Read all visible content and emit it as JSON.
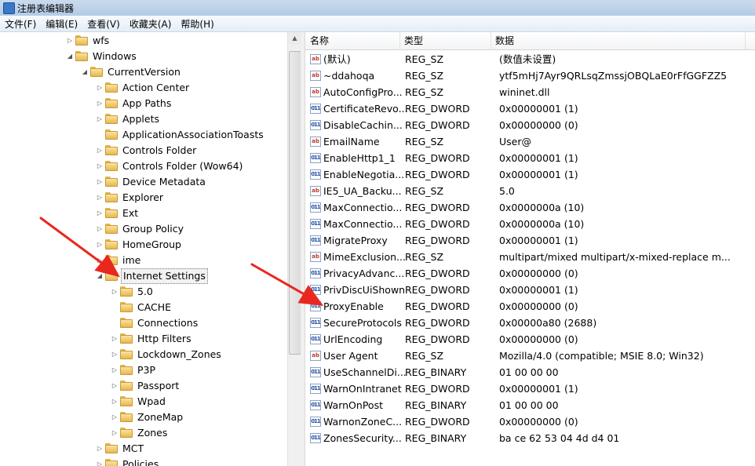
{
  "window": {
    "title": "注册表编辑器"
  },
  "menu": [
    "文件(F)",
    "编辑(E)",
    "查看(V)",
    "收藏夹(A)",
    "帮助(H)"
  ],
  "tree": [
    {
      "label": "wfs",
      "depth": 0,
      "arrow": "collapsed"
    },
    {
      "label": "Windows",
      "depth": 0,
      "arrow": "expanded"
    },
    {
      "label": "CurrentVersion",
      "depth": 1,
      "arrow": "expanded"
    },
    {
      "label": "Action Center",
      "depth": 2,
      "arrow": "collapsed"
    },
    {
      "label": "App Paths",
      "depth": 2,
      "arrow": "collapsed"
    },
    {
      "label": "Applets",
      "depth": 2,
      "arrow": "collapsed"
    },
    {
      "label": "ApplicationAssociationToasts",
      "depth": 2,
      "arrow": "none"
    },
    {
      "label": "Controls Folder",
      "depth": 2,
      "arrow": "collapsed"
    },
    {
      "label": "Controls Folder (Wow64)",
      "depth": 2,
      "arrow": "collapsed"
    },
    {
      "label": "Device Metadata",
      "depth": 2,
      "arrow": "collapsed"
    },
    {
      "label": "Explorer",
      "depth": 2,
      "arrow": "collapsed"
    },
    {
      "label": "Ext",
      "depth": 2,
      "arrow": "collapsed"
    },
    {
      "label": "Group Policy",
      "depth": 2,
      "arrow": "collapsed"
    },
    {
      "label": "HomeGroup",
      "depth": 2,
      "arrow": "collapsed"
    },
    {
      "label": "ime",
      "depth": 2,
      "arrow": "collapsed"
    },
    {
      "label": "Internet Settings",
      "depth": 2,
      "arrow": "expanded",
      "selected": true
    },
    {
      "label": "5.0",
      "depth": 3,
      "arrow": "collapsed"
    },
    {
      "label": "CACHE",
      "depth": 3,
      "arrow": "none"
    },
    {
      "label": "Connections",
      "depth": 3,
      "arrow": "none"
    },
    {
      "label": "Http Filters",
      "depth": 3,
      "arrow": "collapsed"
    },
    {
      "label": "Lockdown_Zones",
      "depth": 3,
      "arrow": "collapsed"
    },
    {
      "label": "P3P",
      "depth": 3,
      "arrow": "collapsed"
    },
    {
      "label": "Passport",
      "depth": 3,
      "arrow": "collapsed"
    },
    {
      "label": "Wpad",
      "depth": 3,
      "arrow": "collapsed"
    },
    {
      "label": "ZoneMap",
      "depth": 3,
      "arrow": "collapsed"
    },
    {
      "label": "Zones",
      "depth": 3,
      "arrow": "collapsed"
    },
    {
      "label": "MCT",
      "depth": 2,
      "arrow": "collapsed"
    },
    {
      "label": "Policies",
      "depth": 2,
      "arrow": "collapsed"
    }
  ],
  "list": {
    "columns": [
      "名称",
      "类型",
      "数据"
    ],
    "rows": [
      {
        "icon": "sz",
        "name": "(默认)",
        "type": "REG_SZ",
        "data": "(数值未设置)"
      },
      {
        "icon": "sz",
        "name": "~ddahoqa",
        "type": "REG_SZ",
        "data": "ytf5mHj7Ayr9QRLsqZmssjOBQLaE0rFfGGFZZ5"
      },
      {
        "icon": "sz",
        "name": "AutoConfigPro...",
        "type": "REG_SZ",
        "data": "wininet.dll"
      },
      {
        "icon": "bin",
        "name": "CertificateRevo...",
        "type": "REG_DWORD",
        "data": "0x00000001 (1)"
      },
      {
        "icon": "bin",
        "name": "DisableCachin...",
        "type": "REG_DWORD",
        "data": "0x00000000 (0)"
      },
      {
        "icon": "sz",
        "name": "EmailName",
        "type": "REG_SZ",
        "data": "User@"
      },
      {
        "icon": "bin",
        "name": "EnableHttp1_1",
        "type": "REG_DWORD",
        "data": "0x00000001 (1)"
      },
      {
        "icon": "bin",
        "name": "EnableNegotia...",
        "type": "REG_DWORD",
        "data": "0x00000001 (1)"
      },
      {
        "icon": "sz",
        "name": "IE5_UA_Backu...",
        "type": "REG_SZ",
        "data": "5.0"
      },
      {
        "icon": "bin",
        "name": "MaxConnectio...",
        "type": "REG_DWORD",
        "data": "0x0000000a (10)"
      },
      {
        "icon": "bin",
        "name": "MaxConnectio...",
        "type": "REG_DWORD",
        "data": "0x0000000a (10)"
      },
      {
        "icon": "bin",
        "name": "MigrateProxy",
        "type": "REG_DWORD",
        "data": "0x00000001 (1)"
      },
      {
        "icon": "sz",
        "name": "MimeExclusion...",
        "type": "REG_SZ",
        "data": "multipart/mixed multipart/x-mixed-replace m..."
      },
      {
        "icon": "bin",
        "name": "PrivacyAdvanc...",
        "type": "REG_DWORD",
        "data": "0x00000000 (0)"
      },
      {
        "icon": "bin",
        "name": "PrivDiscUiShown",
        "type": "REG_DWORD",
        "data": "0x00000001 (1)"
      },
      {
        "icon": "bin",
        "name": "ProxyEnable",
        "type": "REG_DWORD",
        "data": "0x00000000 (0)"
      },
      {
        "icon": "bin",
        "name": "SecureProtocols",
        "type": "REG_DWORD",
        "data": "0x00000a80 (2688)"
      },
      {
        "icon": "bin",
        "name": "UrlEncoding",
        "type": "REG_DWORD",
        "data": "0x00000000 (0)"
      },
      {
        "icon": "sz",
        "name": "User Agent",
        "type": "REG_SZ",
        "data": "Mozilla/4.0 (compatible; MSIE 8.0; Win32)"
      },
      {
        "icon": "bin",
        "name": "UseSchannelDi...",
        "type": "REG_BINARY",
        "data": "01 00 00 00"
      },
      {
        "icon": "bin",
        "name": "WarnOnIntranet",
        "type": "REG_DWORD",
        "data": "0x00000001 (1)"
      },
      {
        "icon": "bin",
        "name": "WarnOnPost",
        "type": "REG_BINARY",
        "data": "01 00 00 00"
      },
      {
        "icon": "bin",
        "name": "WarnonZoneC...",
        "type": "REG_DWORD",
        "data": "0x00000000 (0)"
      },
      {
        "icon": "bin",
        "name": "ZonesSecurity...",
        "type": "REG_BINARY",
        "data": "ba ce 62 53 04 4d d4 01"
      }
    ]
  },
  "icons": {
    "sz": "string-value-icon",
    "bin": "binary-value-icon",
    "folder": "folder-icon"
  },
  "colors": {
    "annotation": "#e8281f",
    "folder": "#e7b84f"
  }
}
